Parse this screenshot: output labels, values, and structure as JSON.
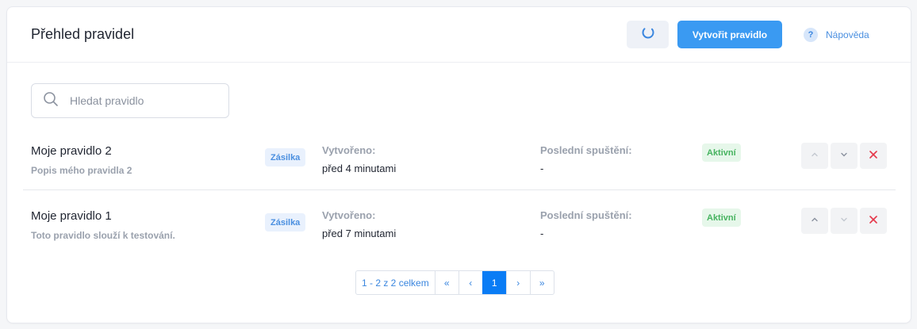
{
  "header": {
    "title": "Přehled pravidel",
    "refresh_icon": "refresh-icon",
    "create_label": "Vytvořit pravidlo",
    "help_icon_glyph": "?",
    "help_label": "Nápověda"
  },
  "search": {
    "placeholder": "Hledat pravidlo",
    "icon": "search-icon"
  },
  "rules": [
    {
      "name": "Moje pravidlo 2",
      "description": "Popis mého pravidla 2",
      "type": "Zásilka",
      "created_label": "Vytvořeno:",
      "created_value": "před 4 minutami",
      "last_run_label": "Poslední spuštění:",
      "last_run_value": "-",
      "status": "Aktivní"
    },
    {
      "name": "Moje pravidlo 1",
      "description": "Toto pravidlo slouží k testování.",
      "type": "Zásilka",
      "created_label": "Vytvořeno:",
      "created_value": "před 7 minutami",
      "last_run_label": "Poslední spuštění:",
      "last_run_value": "-",
      "status": "Aktivní"
    }
  ],
  "pagination": {
    "summary": "1 - 2 z 2 celkem",
    "first": "«",
    "prev": "‹",
    "current": "1",
    "next": "›",
    "last": "»"
  },
  "colors": {
    "primary": "#3a9af2",
    "active_page": "#0a7cf5",
    "status_green": "#46b35f",
    "delete_red": "#e5374a"
  }
}
